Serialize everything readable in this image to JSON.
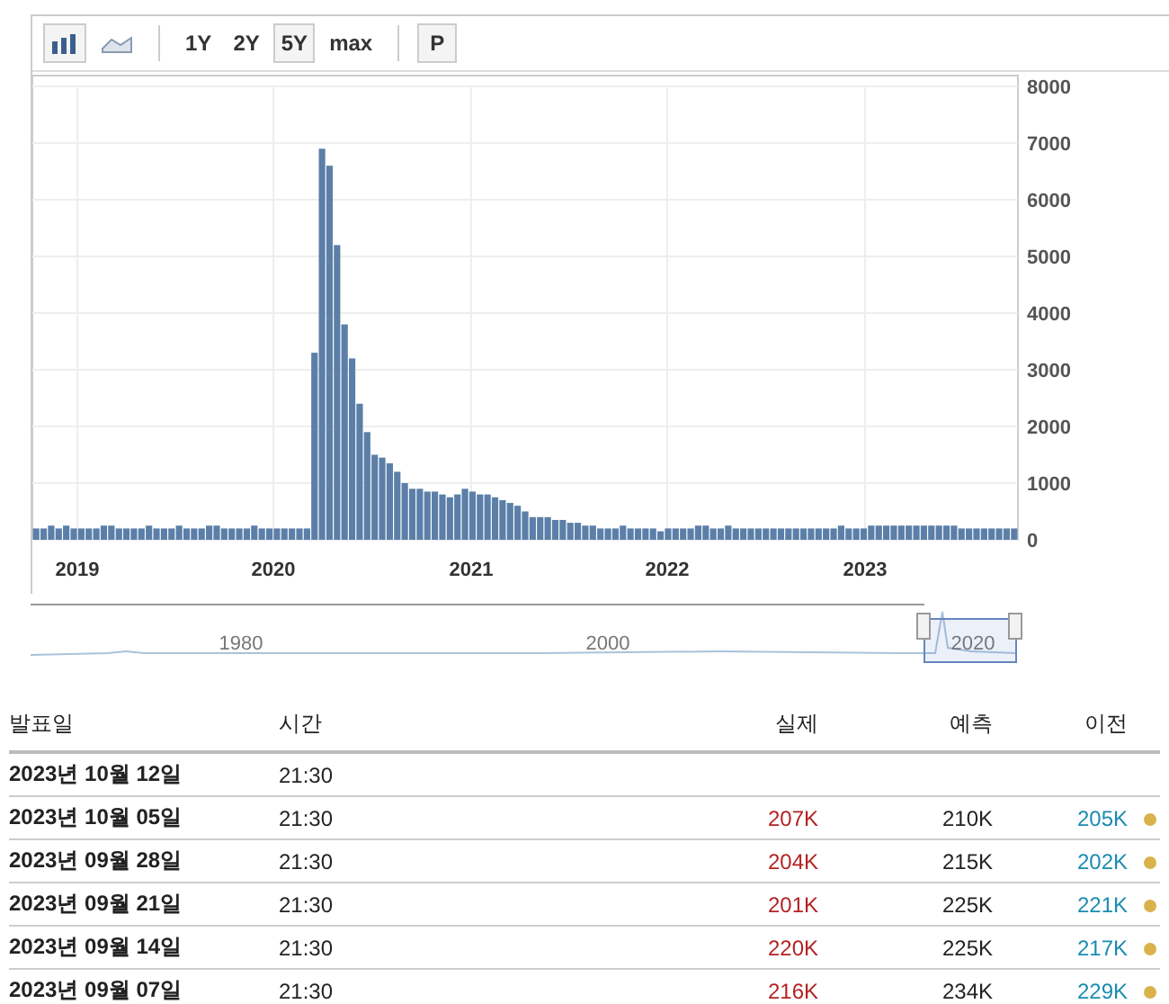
{
  "toolbar": {
    "chart_types": [
      {
        "kind": "bar",
        "selected": true
      },
      {
        "kind": "area",
        "selected": false
      }
    ],
    "ranges": [
      {
        "label": "1Y",
        "selected": false
      },
      {
        "label": "2Y",
        "selected": false
      },
      {
        "label": "5Y",
        "selected": true
      },
      {
        "label": "max",
        "selected": false
      }
    ],
    "extra_button": "P"
  },
  "chart": {
    "x_axis_labels": [
      "2019",
      "2020",
      "2021",
      "2022",
      "2023"
    ],
    "chart_data": {
      "type": "bar",
      "grid": true,
      "ylim": [
        0,
        8000
      ],
      "yticks": [
        0,
        1000,
        2000,
        3000,
        4000,
        5000,
        6000,
        7000,
        8000
      ],
      "series": [
        {
          "color": "#5b7fa8",
          "values": [
            200,
            200,
            250,
            200,
            250,
            200,
            200,
            200,
            200,
            250,
            250,
            200,
            200,
            200,
            200,
            250,
            200,
            200,
            200,
            250,
            200,
            200,
            200,
            250,
            250,
            200,
            200,
            200,
            200,
            250,
            200,
            200,
            200,
            200,
            200,
            200,
            200,
            3300,
            6900,
            6600,
            5200,
            3800,
            3200,
            2400,
            1900,
            1500,
            1450,
            1350,
            1200,
            1000,
            900,
            900,
            850,
            850,
            800,
            750,
            800,
            900,
            850,
            800,
            800,
            750,
            700,
            650,
            600,
            500,
            400,
            400,
            400,
            350,
            350,
            300,
            300,
            250,
            250,
            200,
            200,
            200,
            250,
            200,
            200,
            200,
            200,
            150,
            200,
            200,
            200,
            200,
            250,
            250,
            200,
            200,
            250,
            200,
            200,
            200,
            200,
            200,
            200,
            200,
            200,
            200,
            200,
            200,
            200,
            200,
            200,
            250,
            200,
            200,
            200,
            250,
            250,
            250,
            250,
            250,
            250,
            250,
            250,
            250,
            250,
            250,
            250,
            200,
            200,
            200,
            200,
            200,
            200,
            200,
            200
          ]
        }
      ]
    }
  },
  "navigator": {
    "labels": [
      "1980",
      "2000",
      "2020"
    ]
  },
  "table": {
    "columns": [
      "발표일",
      "시간",
      "실제",
      "예측",
      "이전"
    ],
    "rows": [
      {
        "date": "2023년 10월 12일",
        "time": "21:30",
        "marker": false
      },
      {
        "date": "2023년 10월 05일",
        "time": "21:30",
        "actual": "207K",
        "forecast": "210K",
        "previous": "205K",
        "marker": true
      },
      {
        "date": "2023년 09월 28일",
        "time": "21:30",
        "actual": "204K",
        "forecast": "215K",
        "previous": "202K",
        "marker": true
      },
      {
        "date": "2023년 09월 21일",
        "time": "21:30",
        "actual": "201K",
        "forecast": "225K",
        "previous": "221K",
        "marker": true
      },
      {
        "date": "2023년 09월 14일",
        "time": "21:30",
        "actual": "220K",
        "forecast": "225K",
        "previous": "217K",
        "marker": true
      },
      {
        "date": "2023년 09월 07일",
        "time": "21:30",
        "actual": "216K",
        "forecast": "234K",
        "previous": "229K",
        "marker": true
      }
    ]
  }
}
